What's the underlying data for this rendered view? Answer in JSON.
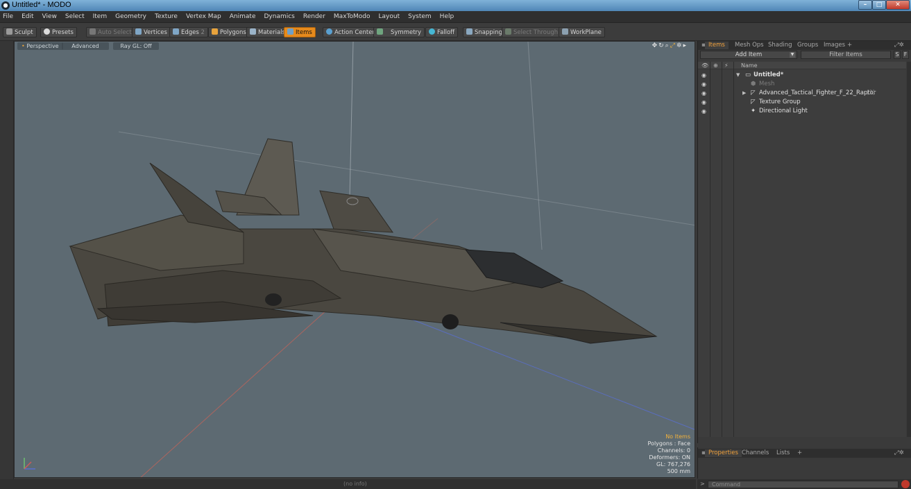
{
  "window": {
    "title": "Untitled* - MODO"
  },
  "menu": [
    "File",
    "Edit",
    "View",
    "Select",
    "Item",
    "Geometry",
    "Texture",
    "Vertex Map",
    "Animate",
    "Dynamics",
    "Render",
    "MaxToModo",
    "Layout",
    "System",
    "Help"
  ],
  "toolbar": {
    "sculpt": "Sculpt",
    "presets": "Presets",
    "auto_select": "Auto Select",
    "vertices": "Vertices",
    "edges": "Edges",
    "edges_count": "2",
    "polygons": "Polygons",
    "materials": "Materials",
    "items": "Items",
    "action_center": "Action Center",
    "symmetry": "Symmetry",
    "falloff": "Falloff",
    "snapping": "Snapping",
    "select_through": "Select Through",
    "workplane": "WorkPlane"
  },
  "viewport": {
    "view": "Perspective",
    "mode": "Advanced",
    "raygl": "Ray GL: Off",
    "info": {
      "no_items": "No Items",
      "polygons": "Polygons : Face",
      "channels": "Channels: 0",
      "deformers": "Deformers: ON",
      "gl": "GL: 767,276",
      "scale": "500 mm"
    }
  },
  "items_panel": {
    "tabs": [
      "Items",
      "Mesh Ops",
      "Shading",
      "Groups",
      "Images",
      "+"
    ],
    "add_item": "Add Item",
    "filter_placeholder": "Filter Items",
    "s_btn": "S",
    "f_btn": "F",
    "name_header": "Name",
    "rows": [
      {
        "label": "Untitled*",
        "expanded": true
      },
      {
        "label": "Mesh",
        "dim": true
      },
      {
        "label": "Advanced_Tactical_Fighter_F_22_Raptor",
        "count": "(3)"
      },
      {
        "label": "Texture Group"
      },
      {
        "label": "Directional Light"
      }
    ]
  },
  "properties_panel": {
    "tabs": [
      "Properties",
      "Channels",
      "Lists",
      "+"
    ]
  },
  "status": {
    "info": "(no info)"
  },
  "command": {
    "prompt": ">",
    "placeholder": "Command"
  },
  "colors": {
    "accent": "#e68a1c",
    "viewport_bg": "#5d6a72"
  }
}
